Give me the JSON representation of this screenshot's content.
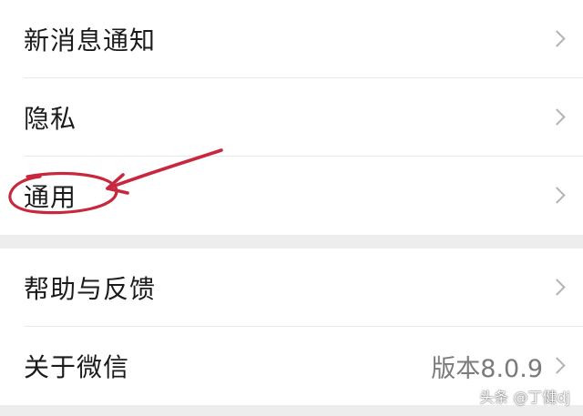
{
  "settings": {
    "items": [
      {
        "label": "新消息通知"
      },
      {
        "label": "隐私"
      },
      {
        "label": "通用"
      },
      {
        "label": "帮助与反馈"
      },
      {
        "label": "关于微信",
        "value": "版本8.0.9"
      }
    ]
  },
  "annotation": {
    "color": "#c8283e"
  },
  "watermark": "头条 @丁健dj"
}
